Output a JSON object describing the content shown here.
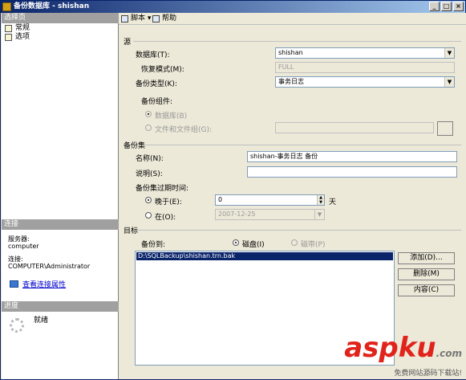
{
  "window": {
    "title": "备份数据库 - shishan",
    "min": "_",
    "max": "□",
    "close": "×"
  },
  "left": {
    "select_page_header": "选择页",
    "pages": [
      {
        "label": "常规"
      },
      {
        "label": "选项"
      }
    ],
    "connection_header": "连接",
    "server_label": "服务器:",
    "server_value": "computer",
    "connection_label": "连接:",
    "connection_value": "COMPUTER\\Administrator",
    "view_properties_link": "查看连接属性",
    "progress_header": "进度",
    "progress_status": "就绪"
  },
  "toolbar": {
    "script_label": "脚本",
    "script_arrow": "▾",
    "help_label": "帮助"
  },
  "source": {
    "group_label": "源",
    "database_label": "数据库(T):",
    "database_value": "shishan",
    "recovery_label": "恢复模式(M):",
    "recovery_value": "FULL",
    "backup_type_label": "备份类型(K):",
    "backup_type_value": "事务日志",
    "component_label": "备份组件:",
    "component_db_label": "数据库(B)",
    "component_files_label": "文件和文件组(G):",
    "files_browse": ""
  },
  "backup_set": {
    "group_label": "备份集",
    "name_label": "名称(N):",
    "name_value": "shishan-事务日志  备份",
    "description_label": "说明(S):",
    "description_value": "",
    "expire_label": "备份集过期时间:",
    "after_label": "晚于(E):",
    "after_value": "0",
    "after_unit": "天",
    "on_label": "在(O):",
    "on_value": "2007-12-25"
  },
  "destination": {
    "group_label": "目标",
    "backup_to_label": "备份到:",
    "disk_label": "磁盘(I)",
    "tape_label": "磁带(P)",
    "paths": [
      "D:\\SQLBackup\\shishan.trn.bak"
    ],
    "add_button": "添加(D)...",
    "remove_button": "删除(M)",
    "contents_button": "内容(C)"
  },
  "watermark": {
    "logo_main": "asp",
    "logo_ku": "ku",
    "logo_tld": ".com",
    "subtitle": "免费网站源码下载站!"
  }
}
